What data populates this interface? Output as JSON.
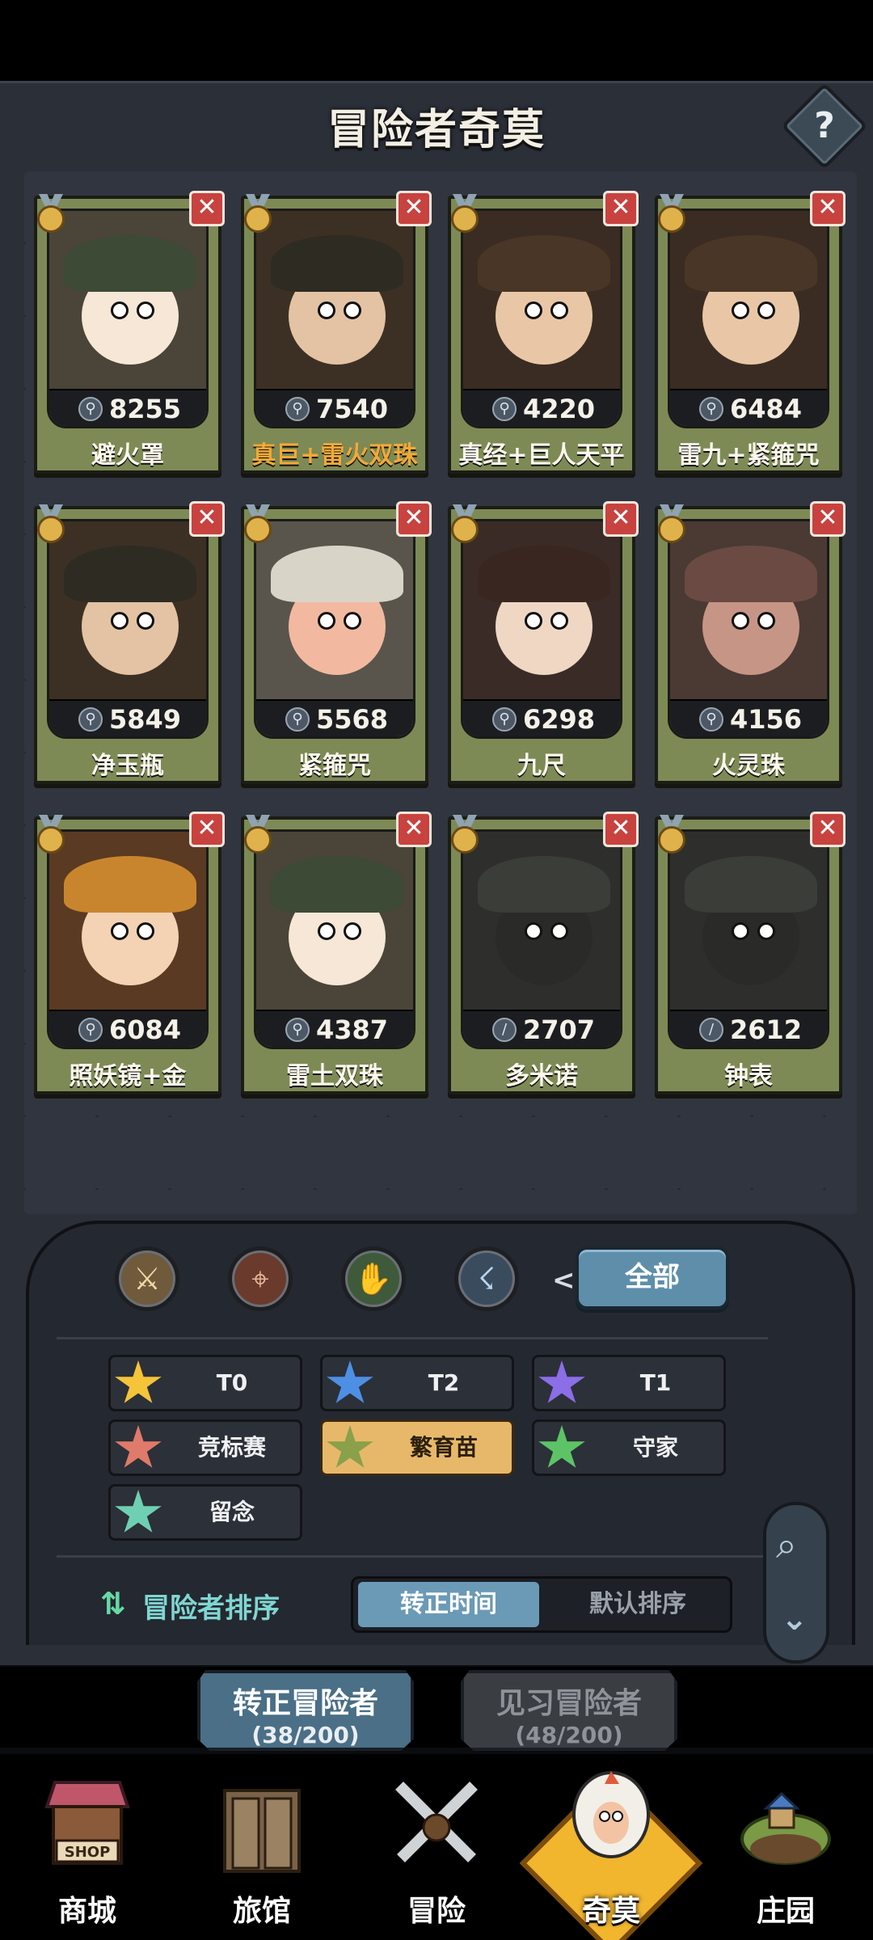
{
  "header": {
    "title": "冒险者奇莫",
    "help_label": "?"
  },
  "cards": [
    {
      "score": "8255",
      "name": "避火罩",
      "class_icon": "mage-staff-icon",
      "highlight": false
    },
    {
      "score": "7540",
      "name": "真巨+雷火双珠",
      "class_icon": "mage-staff-icon",
      "highlight": true
    },
    {
      "score": "4220",
      "name": "真经+巨人天平",
      "class_icon": "mage-staff-icon",
      "highlight": false
    },
    {
      "score": "6484",
      "name": "雷九+紧箍咒",
      "class_icon": "mage-staff-icon",
      "highlight": false
    },
    {
      "score": "5849",
      "name": "净玉瓶",
      "class_icon": "mage-staff-icon",
      "highlight": false
    },
    {
      "score": "5568",
      "name": "紧箍咒",
      "class_icon": "mage-staff-icon",
      "highlight": false
    },
    {
      "score": "6298",
      "name": "九尺",
      "class_icon": "mage-staff-icon",
      "highlight": false
    },
    {
      "score": "4156",
      "name": "火灵珠",
      "class_icon": "mage-staff-icon",
      "highlight": false
    },
    {
      "score": "6084",
      "name": "照妖镜+金",
      "class_icon": "mage-staff-icon",
      "highlight": false
    },
    {
      "score": "4387",
      "name": "雷土双珠",
      "class_icon": "mage-staff-icon",
      "highlight": false
    },
    {
      "score": "2707",
      "name": "多米诺",
      "class_icon": "sword-icon",
      "highlight": false
    },
    {
      "score": "2612",
      "name": "钟表",
      "class_icon": "sword-icon",
      "highlight": false
    }
  ],
  "card_close_label": "✕",
  "class_filters": [
    {
      "icon": "sword-class-icon",
      "glyph": "⚔"
    },
    {
      "icon": "crosshair-class-icon",
      "glyph": "⌖"
    },
    {
      "icon": "hand-class-icon",
      "glyph": "✋"
    },
    {
      "icon": "staff-class-icon",
      "glyph": "☇"
    }
  ],
  "all_button": "全部",
  "tags": [
    {
      "label": "T0",
      "color": "#f5c43a",
      "active": false
    },
    {
      "label": "T2",
      "color": "#4e8fe6",
      "active": false
    },
    {
      "label": "T1",
      "color": "#8b6ee8",
      "active": false
    },
    {
      "label": "竞标赛",
      "color": "#e07a6a",
      "active": false
    },
    {
      "label": "繁育苗",
      "color": "#8aa04a",
      "active": true
    },
    {
      "label": "守家",
      "color": "#5cc466",
      "active": false
    },
    {
      "label": "留念",
      "color": "#6fcfb3",
      "active": false
    }
  ],
  "sort": {
    "label": "冒险者排序",
    "options": [
      "转正时间",
      "默认排序"
    ],
    "selected": "转正时间"
  },
  "roster_tabs": [
    {
      "title": "转正冒险者",
      "count": "(38/200)",
      "active": true
    },
    {
      "title": "见习冒险者",
      "count": "(48/200)",
      "active": false
    }
  ],
  "bottom_nav": [
    {
      "label": "商城",
      "icon": "shop-icon",
      "active": false
    },
    {
      "label": "旅馆",
      "icon": "inn-gate-icon",
      "active": false
    },
    {
      "label": "冒险",
      "icon": "crossed-swords-icon",
      "active": false
    },
    {
      "label": "奇莫",
      "icon": "chimo-character-icon",
      "active": true
    },
    {
      "label": "庄园",
      "icon": "manor-island-icon",
      "active": false
    }
  ],
  "shop_sign": "SHOP"
}
